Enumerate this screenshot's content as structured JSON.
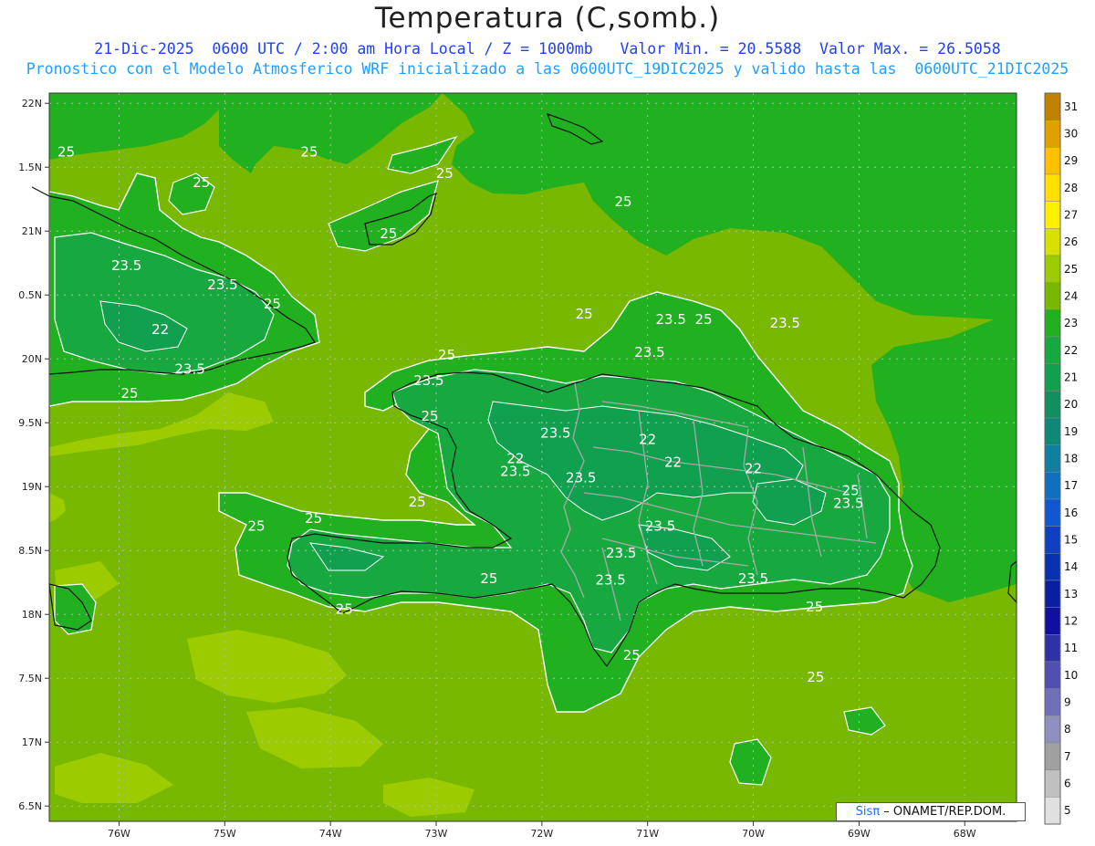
{
  "title": "Temperatura (C,somb.)",
  "subtitle_line1": "21-Dic-2025  0600 UTC / 2:00 am Hora Local / Z = 1000mb   Valor Min. = 20.5588  Valor Max. = 26.5058",
  "subtitle_line2": "Pronostico con el Modelo Atmosferico WRF inicializado a las 0600UTC_19DIC2025 y valido hasta las  0600UTC_21DIC2025",
  "credit": {
    "brand": "Sis",
    "brand_symbol": "π",
    "text": "– ONAMET/REP.DOM."
  },
  "axes": {
    "y_ticks": [
      "22N",
      "1.5N",
      "21N",
      "0.5N",
      "20N",
      "9.5N",
      "19N",
      "8.5N",
      "18N",
      "7.5N",
      "17N",
      "6.5N"
    ],
    "x_ticks": [
      "76W",
      "75W",
      "74W",
      "73W",
      "72W",
      "71W",
      "70W",
      "69W",
      "68W"
    ]
  },
  "colorbar": {
    "levels": [
      "31",
      "30",
      "29",
      "28",
      "27",
      "26",
      "25",
      "24",
      "23",
      "22",
      "21",
      "20",
      "19",
      "18",
      "17",
      "16",
      "15",
      "14",
      "13",
      "12",
      "11",
      "10",
      "9",
      "8",
      "7",
      "6",
      "5"
    ],
    "colors": [
      "#c08000",
      "#e0a000",
      "#ffc000",
      "#ffe000",
      "#fff000",
      "#d8e000",
      "#9ccc00",
      "#78b800",
      "#20b020",
      "#18a840",
      "#10a050",
      "#109060",
      "#108878",
      "#1080a0",
      "#1070c0",
      "#1058d0",
      "#1040c0",
      "#0830b0",
      "#0820a0",
      "#1010a0",
      "#3030a8",
      "#5050b0",
      "#7070b8",
      "#9090c0",
      "#a0a0a0",
      "#c0c0c0",
      "#e0e0e0"
    ]
  },
  "contour_labels": [
    {
      "text": "25",
      "lon": -76.5,
      "lat": 21.62
    },
    {
      "text": "25",
      "lon": -75.22,
      "lat": 21.38
    },
    {
      "text": "25",
      "lon": -74.2,
      "lat": 21.62
    },
    {
      "text": "25",
      "lon": -72.92,
      "lat": 21.45
    },
    {
      "text": "25",
      "lon": -71.23,
      "lat": 21.23
    },
    {
      "text": "25",
      "lon": -73.45,
      "lat": 20.98
    },
    {
      "text": "23.5",
      "lon": -75.93,
      "lat": 20.73
    },
    {
      "text": "23.5",
      "lon": -75.02,
      "lat": 20.58
    },
    {
      "text": "22",
      "lon": -75.61,
      "lat": 20.23
    },
    {
      "text": "25",
      "lon": -74.55,
      "lat": 20.43
    },
    {
      "text": "23.5",
      "lon": -75.33,
      "lat": 19.92
    },
    {
      "text": "25",
      "lon": -75.9,
      "lat": 19.73
    },
    {
      "text": "25",
      "lon": -72.9,
      "lat": 20.03
    },
    {
      "text": "23.5",
      "lon": -73.07,
      "lat": 19.83
    },
    {
      "text": "25",
      "lon": -73.06,
      "lat": 19.55
    },
    {
      "text": "23.5",
      "lon": -71.87,
      "lat": 19.42
    },
    {
      "text": "22",
      "lon": -71.0,
      "lat": 19.37
    },
    {
      "text": "25",
      "lon": -70.47,
      "lat": 20.31
    },
    {
      "text": "23.5",
      "lon": -70.78,
      "lat": 20.31
    },
    {
      "text": "23.5",
      "lon": -70.98,
      "lat": 20.05
    },
    {
      "text": "25",
      "lon": -71.6,
      "lat": 20.35
    },
    {
      "text": "23.5",
      "lon": -69.7,
      "lat": 20.28
    },
    {
      "text": "22",
      "lon": -72.25,
      "lat": 19.22
    },
    {
      "text": "22",
      "lon": -70.76,
      "lat": 19.19
    },
    {
      "text": "22",
      "lon": -70.0,
      "lat": 19.14
    },
    {
      "text": "23.5",
      "lon": -72.25,
      "lat": 19.12
    },
    {
      "text": "23.5",
      "lon": -71.63,
      "lat": 19.07
    },
    {
      "text": "25",
      "lon": -69.08,
      "lat": 18.97
    },
    {
      "text": "23.5",
      "lon": -69.1,
      "lat": 18.87
    },
    {
      "text": "25",
      "lon": -73.18,
      "lat": 18.88
    },
    {
      "text": "25",
      "lon": -74.16,
      "lat": 18.75
    },
    {
      "text": "25",
      "lon": -74.7,
      "lat": 18.69
    },
    {
      "text": "23.5",
      "lon": -70.88,
      "lat": 18.69
    },
    {
      "text": "23.5",
      "lon": -71.25,
      "lat": 18.48
    },
    {
      "text": "23.5",
      "lon": -71.35,
      "lat": 18.27
    },
    {
      "text": "25",
      "lon": -72.5,
      "lat": 18.28
    },
    {
      "text": "23.5",
      "lon": -70.0,
      "lat": 18.28
    },
    {
      "text": "25",
      "lon": -73.87,
      "lat": 18.04
    },
    {
      "text": "25",
      "lon": -69.42,
      "lat": 18.06
    },
    {
      "text": "25",
      "lon": -71.15,
      "lat": 17.68
    },
    {
      "text": "25",
      "lon": -69.41,
      "lat": 17.51
    }
  ]
}
